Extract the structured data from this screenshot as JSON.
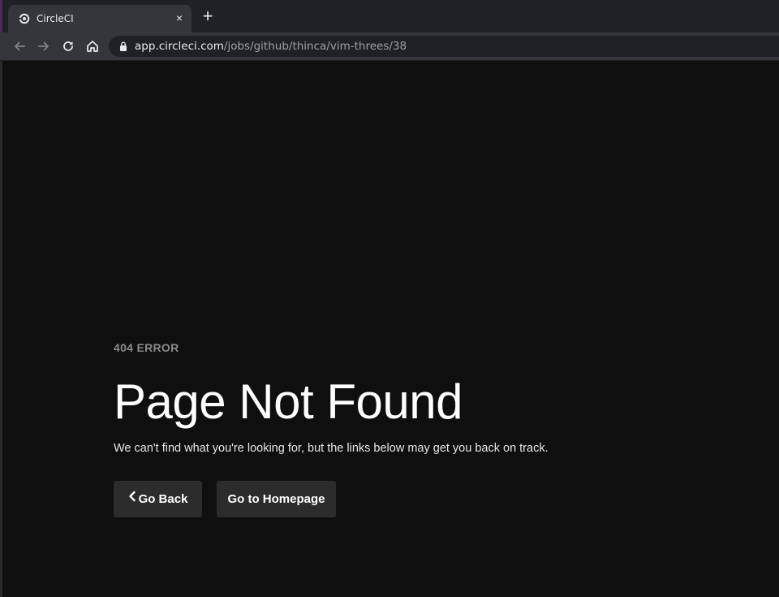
{
  "browser": {
    "tab": {
      "title": "CircleCI",
      "close_glyph": "×",
      "favicon": "circleci-logo-icon"
    },
    "new_tab_glyph": "+",
    "toolbar": {
      "back_icon": "arrow-left-icon",
      "forward_icon": "arrow-right-icon",
      "reload_icon": "reload-icon",
      "home_icon": "home-icon"
    },
    "address": {
      "host": "app.circleci.com",
      "path": "/jobs/github/thinca/vim-threes/38",
      "lock_icon": "lock-icon"
    }
  },
  "page": {
    "error_code": "404 ERROR",
    "title": "Page Not Found",
    "message": "We can't find what you're looking for, but the links below may get you back on track.",
    "buttons": {
      "back_label": "Go Back",
      "home_label": "Go to Homepage"
    }
  },
  "colors": {
    "background": "#0f0f0f",
    "button_bg": "#2c2c2c",
    "muted_text": "#8a8a8a",
    "chrome_tab": "#35363a",
    "chrome_strip": "#202124"
  }
}
